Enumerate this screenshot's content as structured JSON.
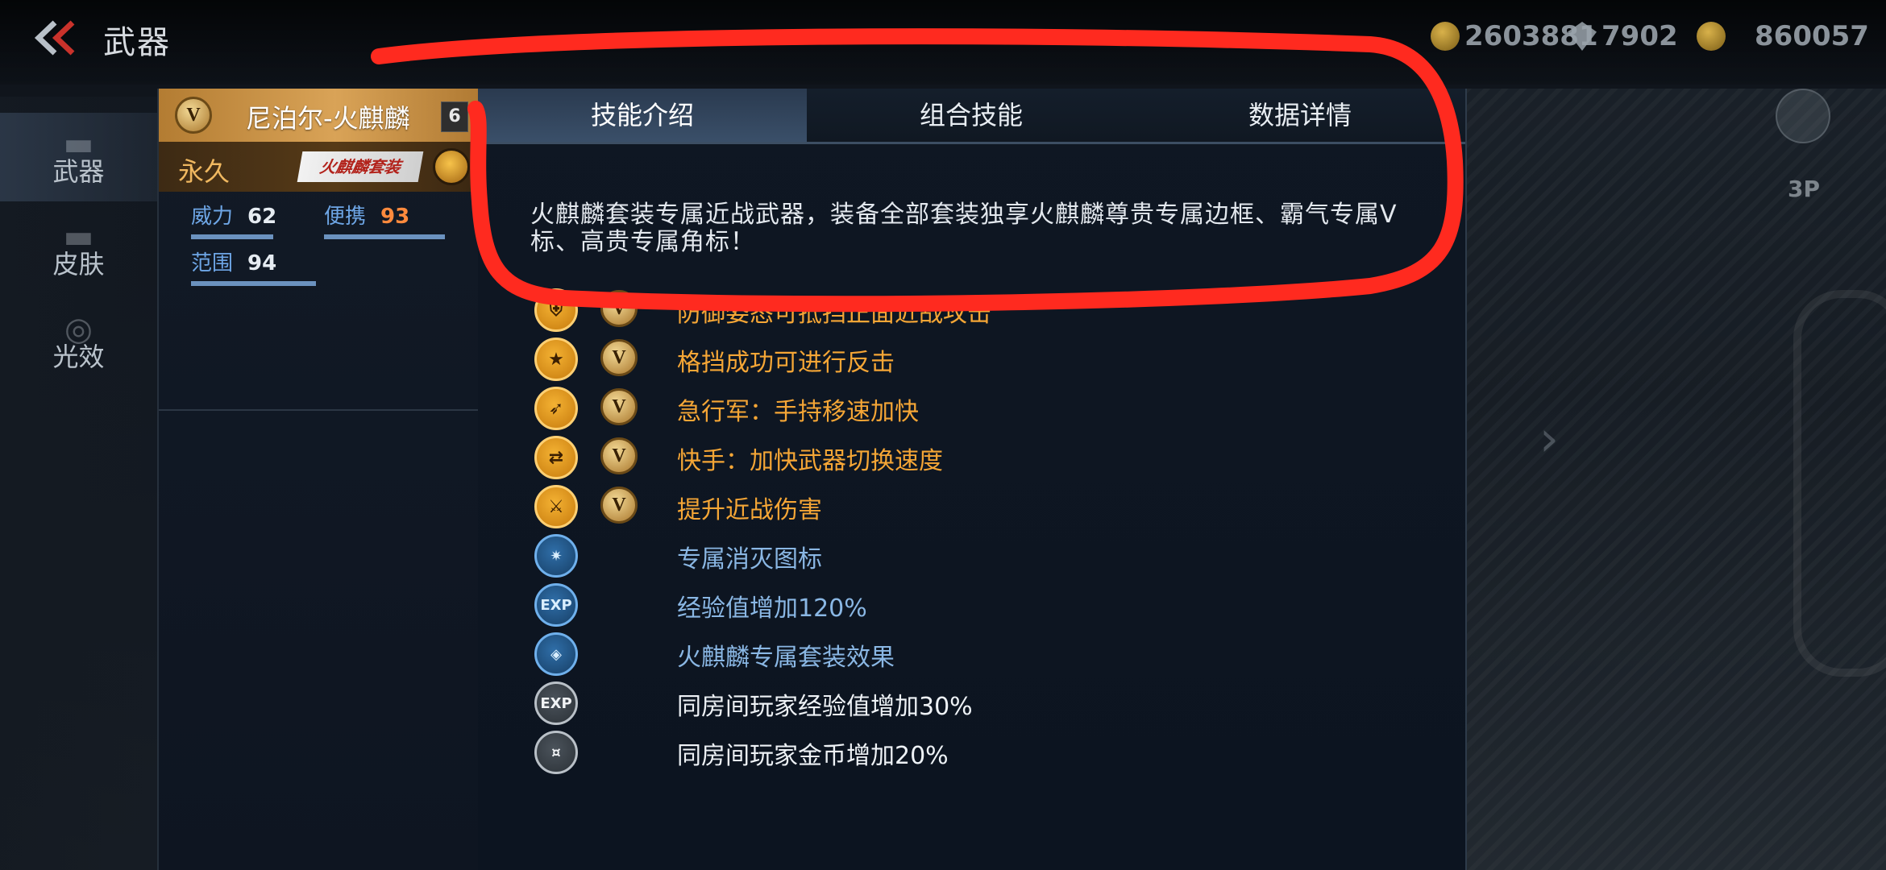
{
  "header": {
    "title": "武器",
    "currencies": [
      {
        "name": "gold",
        "value": "2603881"
      },
      {
        "name": "diamond",
        "value": "7902"
      },
      {
        "name": "coupon",
        "value": "860057"
      }
    ]
  },
  "nav": {
    "items": [
      {
        "label": "武器",
        "icon": "rifle-icon",
        "active": true
      },
      {
        "label": "皮肤",
        "icon": "rifle-skin-icon",
        "active": false
      },
      {
        "label": "光效",
        "icon": "glow-effect-icon",
        "active": false
      }
    ]
  },
  "weapon": {
    "name": "尼泊尔-火麒麟",
    "level": "6",
    "duration": "永久",
    "suit_tag": "火麒麟套装",
    "stats": [
      {
        "name": "威力",
        "value": "62",
        "fraction": 0.62
      },
      {
        "name": "便携",
        "value": "93",
        "fraction": 0.93
      },
      {
        "name": "范围",
        "value": "94",
        "fraction": 0.94
      }
    ]
  },
  "tabs": [
    {
      "label": "技能介绍",
      "active": true
    },
    {
      "label": "组合技能",
      "active": false
    },
    {
      "label": "数据详情",
      "active": false
    }
  ],
  "description": "火麒麟套装专属近战武器，装备全部套装独享火麒麟尊贵专属边框、霸气专属V标、高贵专属角标！",
  "skills": [
    {
      "text": "防御姿态可抵挡正面近战攻击",
      "icon": "shield-icon",
      "style": "gold",
      "vip": true
    },
    {
      "text": "格挡成功可进行反击",
      "icon": "star-icon",
      "style": "gold",
      "vip": true
    },
    {
      "text": "急行军：手持移速加快",
      "icon": "running-man-icon",
      "style": "gold",
      "vip": true
    },
    {
      "text": "快手：加快武器切换速度",
      "icon": "weapon-swap-icon",
      "style": "gold",
      "vip": true
    },
    {
      "text": "提升近战伤害",
      "icon": "melee-attack-icon",
      "style": "gold",
      "vip": true
    },
    {
      "text": "专属消灭图标",
      "icon": "kill-icon",
      "style": "blue",
      "vip": false
    },
    {
      "text": "经验值增加120%",
      "icon": "exp-plus-icon",
      "style": "blue",
      "vip": false
    },
    {
      "text": "火麒麟专属套装效果",
      "icon": "suit-effect-icon",
      "style": "blue",
      "vip": false
    },
    {
      "text": "同房间玩家经验值增加30%",
      "icon": "team-exp-icon",
      "style": "gray",
      "vip": false
    },
    {
      "text": "同房间玩家金币增加20%",
      "icon": "team-coin-icon",
      "style": "gray",
      "vip": false
    }
  ],
  "vip_badge": "V",
  "hud": {
    "view_mode": "3P"
  },
  "colors": {
    "accent_gold": "#f5a636",
    "accent_blue": "#8ab7e4",
    "annotation_red": "#ff2a1f"
  }
}
